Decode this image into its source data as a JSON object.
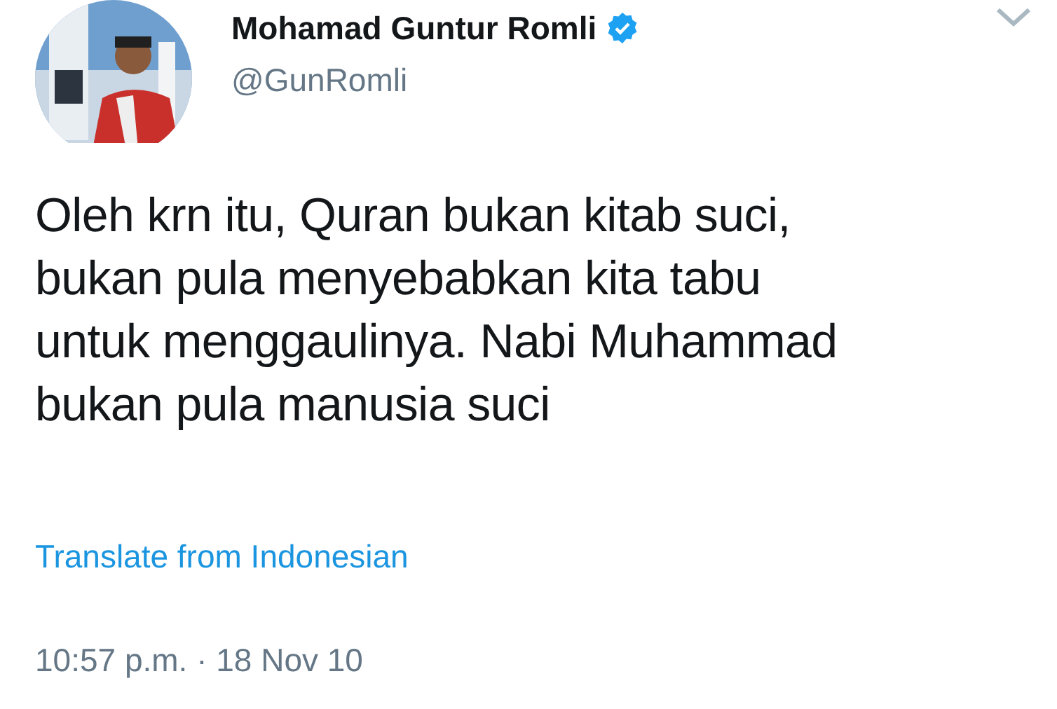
{
  "author": {
    "name": "Mohamad Guntur Romli",
    "verified": true,
    "handle": "@GunRomli"
  },
  "tweet": {
    "text": "Oleh krn itu, Quran bukan kitab suci,\nbukan pula menyebabkan kita tabu\nuntuk menggaulinya. Nabi Muhammad\nbukan pula manusia suci"
  },
  "translate_link": "Translate from Indonesian",
  "timestamp": "10:57 p.m. · 18 Nov 10"
}
